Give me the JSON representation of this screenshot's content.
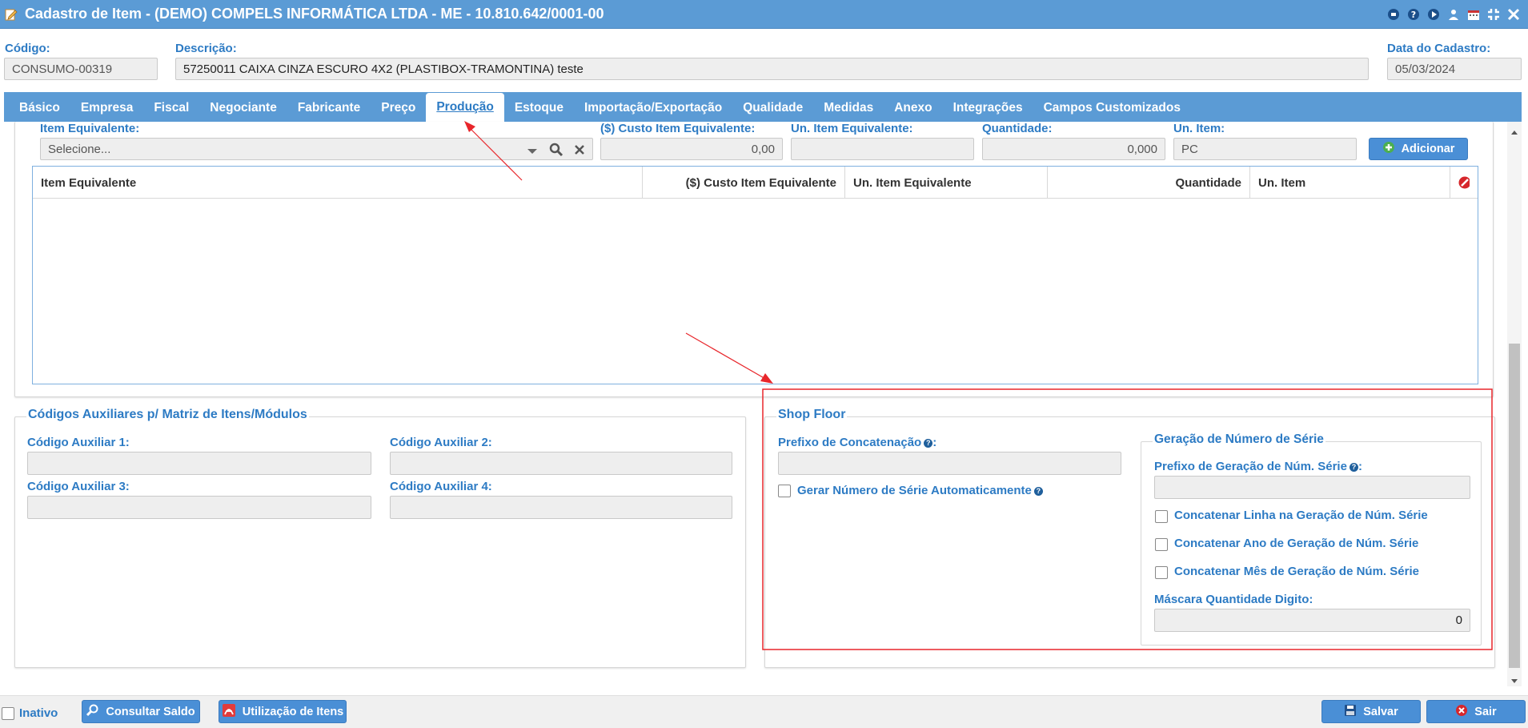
{
  "window": {
    "title": "Cadastro de Item - (DEMO) COMPELS INFORMÁTICA LTDA - ME - 10.810.642/0001-00"
  },
  "header": {
    "codigo_label": "Código:",
    "codigo_value": "CONSUMO-00319",
    "descricao_label": "Descrição:",
    "descricao_value": "57250011 CAIXA CINZA ESCURO 4X2 (PLASTIBOX-TRAMONTINA) teste",
    "data_label": "Data do Cadastro:",
    "data_value": "05/03/2024"
  },
  "tabs": [
    {
      "label": "Básico"
    },
    {
      "label": "Empresa"
    },
    {
      "label": "Fiscal"
    },
    {
      "label": "Negociante"
    },
    {
      "label": "Fabricante"
    },
    {
      "label": "Preço"
    },
    {
      "label": "Produção",
      "active": true
    },
    {
      "label": "Estoque"
    },
    {
      "label": "Importação/Exportação"
    },
    {
      "label": "Qualidade"
    },
    {
      "label": "Medidas"
    },
    {
      "label": "Anexo"
    },
    {
      "label": "Integrações"
    },
    {
      "label": "Campos Customizados"
    }
  ],
  "equivalente": {
    "item_label": "Item Equivalente:",
    "item_placeholder": "Selecione...",
    "custo_label": "($) Custo Item Equivalente:",
    "custo_value": "0,00",
    "un_item_eq_label": "Un. Item Equivalente:",
    "un_item_eq_value": "",
    "quantidade_label": "Quantidade:",
    "quantidade_value": "0,000",
    "un_item_label": "Un. Item:",
    "un_item_value": "PC",
    "adicionar_label": "Adicionar",
    "columns": [
      "Item Equivalente",
      "($) Custo Item Equivalente",
      "Un. Item Equivalente",
      "Quantidade",
      "Un. Item"
    ]
  },
  "codigos_auxiliares": {
    "title": "Códigos Auxiliares p/ Matriz de Itens/Módulos",
    "aux1_label": "Código Auxiliar 1:",
    "aux2_label": "Código Auxiliar 2:",
    "aux3_label": "Código Auxiliar 3:",
    "aux4_label": "Código Auxiliar 4:"
  },
  "shop_floor": {
    "title": "Shop Floor",
    "prefixo_label": "Prefixo de Concatenação",
    "gerar_label": "Gerar Número de Série Automaticamente",
    "geracao_title": "Geração de Número de Série",
    "prefixo_geracao_label": "Prefixo de Geração de Núm. Série",
    "concat_linha_label": "Concatenar Linha na Geração de Núm. Série",
    "concat_ano_label": "Concatenar Ano de Geração de Núm. Série",
    "concat_mes_label": "Concatenar Mês de Geração de Núm. Série",
    "mascara_label": "Máscara Quantidade Digito:",
    "mascara_value": "0"
  },
  "footer": {
    "inativo_label": "Inativo",
    "consultar_saldo_label": "Consultar Saldo",
    "utilizacao_label": "Utilização de Itens",
    "salvar_label": "Salvar",
    "sair_label": "Sair"
  },
  "colors": {
    "primary": "#5b9bd5",
    "label": "#2d7bc4",
    "annotation": "#e8262b"
  }
}
